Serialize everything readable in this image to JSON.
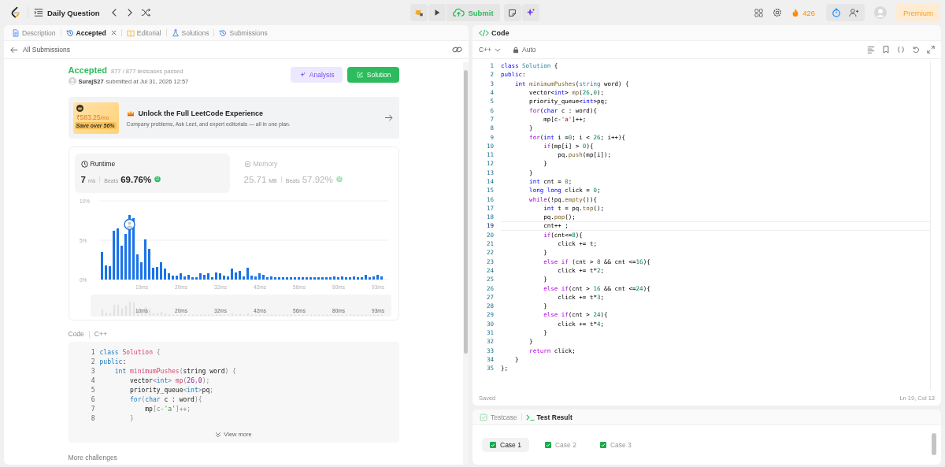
{
  "top_bar": {
    "problem_list": "Daily Question",
    "submit": "Submit",
    "streak": "426",
    "premium": "Premium"
  },
  "left_tabs": [
    {
      "kind": "description",
      "label": "Description",
      "selected": false,
      "closable": false
    },
    {
      "kind": "result",
      "label": "Accepted",
      "selected": true,
      "closable": true
    },
    {
      "kind": "editorial",
      "label": "Editorial",
      "selected": false,
      "closable": false
    },
    {
      "kind": "solutions",
      "label": "Solutions",
      "selected": false,
      "closable": false
    },
    {
      "kind": "submissions",
      "label": "Submissions",
      "selected": false,
      "closable": false
    }
  ],
  "back_link": "All Submissions",
  "submission": {
    "status": "Accepted",
    "testcases": "877 / 877 testcases passed",
    "user": "SurajS27",
    "submitted": "submitted at Jul 31, 2026 12:57",
    "analysis": "Analysis",
    "solution": "Solution"
  },
  "promo": {
    "price": "₹583.25",
    "period": "/mo",
    "save": "Save over 56%",
    "title": "Unlock the Full LeetCode Experience",
    "subtitle": "Company problems, Ask Leet, and expert editorials — all in one plan."
  },
  "stats_panel": {
    "stats": [
      {
        "kind": "runtime",
        "label": "Runtime",
        "value": "7",
        "unit": "ms",
        "beats_label": "Beats",
        "beats": "69.76%",
        "selected": true
      },
      {
        "kind": "memory",
        "label": "Memory",
        "value": "25.71",
        "unit": "MB",
        "beats_label": "Beats",
        "beats": "57.92%",
        "selected": false
      }
    ],
    "chart_data": {
      "type": "bar",
      "ylim": [
        0,
        10
      ],
      "yticks": [
        {
          "value": 0,
          "label": "0%"
        },
        {
          "value": 5,
          "label": "5%"
        },
        {
          "value": 10,
          "label": "10%"
        }
      ],
      "categories": [
        null,
        null,
        null,
        null,
        null,
        null,
        null,
        null,
        null,
        null,
        "10ms",
        null,
        null,
        null,
        null,
        null,
        null,
        null,
        null,
        null,
        "20ms",
        null,
        null,
        null,
        null,
        null,
        null,
        null,
        null,
        null,
        "32ms",
        null,
        null,
        null,
        null,
        null,
        null,
        null,
        null,
        null,
        "42ms",
        null,
        null,
        null,
        null,
        null,
        null,
        null,
        null,
        null,
        "56ms",
        null,
        null,
        null,
        null,
        null,
        null,
        null,
        null,
        null,
        "80ms",
        null,
        null,
        null,
        null,
        null,
        null,
        null,
        null,
        null,
        "93ms",
        null
      ],
      "values": [
        3.5,
        1.8,
        1.7,
        6.2,
        6.5,
        4.3,
        5.8,
        8.2,
        7.8,
        3.2,
        2.2,
        5.1,
        3.9,
        1.5,
        1.6,
        2.2,
        1.4,
        0.8,
        0.5,
        0.5,
        0.8,
        0.4,
        0.6,
        0.3,
        0.3,
        0.8,
        0.6,
        0.8,
        0.3,
        0.9,
        0.8,
        0.5,
        0.4,
        1.4,
        0.9,
        1.1,
        0.4,
        1.5,
        0.5,
        0.4,
        0.8,
        0.6,
        0.3,
        0.4,
        0.3,
        0.3,
        0.3,
        0.3,
        0.3,
        0.3,
        0.3,
        0.3,
        0.3,
        0.3,
        0.3,
        0.3,
        0.3,
        0.3,
        0.3,
        0.4,
        0.3,
        0.4,
        0.3,
        0.3,
        0.4,
        0.3,
        0.3,
        0.6,
        0.3,
        0.4,
        0.6,
        0.4
      ]
    },
    "overview_labels": [
      "10ms",
      "20ms",
      "32ms",
      "42ms",
      "56ms",
      "80ms",
      "93ms"
    ]
  },
  "code_header": {
    "label": "Code",
    "language": "C++"
  },
  "snippet": {
    "view_more": "View more",
    "lines": [
      {
        "no": "1",
        "tokens": [
          {
            "text": "class",
            "kind": "kw"
          },
          {
            "text": " Solution",
            "kind": "type"
          },
          {
            "text": " {",
            "kind": "punct"
          }
        ]
      },
      {
        "no": "2",
        "tokens": [
          {
            "text": "public",
            "kind": "kw"
          },
          {
            "text": ":",
            "kind": "txt"
          }
        ]
      },
      {
        "no": "3",
        "tokens": [
          {
            "text": "    int",
            "kind": "kw"
          },
          {
            "text": " minimumPushes",
            "kind": "fn"
          },
          {
            "text": "(",
            "kind": "punct"
          },
          {
            "text": "string word",
            "kind": "txt"
          },
          {
            "text": ") {",
            "kind": "punct"
          }
        ]
      },
      {
        "no": "4",
        "tokens": [
          {
            "text": "        vector",
            "kind": "txt"
          },
          {
            "text": "<",
            "kind": "punct"
          },
          {
            "text": "int",
            "kind": "kw"
          },
          {
            "text": "> ",
            "kind": "punct"
          },
          {
            "text": "mp",
            "kind": "fn"
          },
          {
            "text": "(",
            "kind": "punct"
          },
          {
            "text": "26",
            "kind": "num"
          },
          {
            "text": ",",
            "kind": "punct"
          },
          {
            "text": "0",
            "kind": "num"
          },
          {
            "text": ");",
            "kind": "punct"
          }
        ]
      },
      {
        "no": "5",
        "tokens": [
          {
            "text": "        priority_queue",
            "kind": "txt"
          },
          {
            "text": "<",
            "kind": "punct"
          },
          {
            "text": "int",
            "kind": "kw"
          },
          {
            "text": ">",
            "kind": "punct"
          },
          {
            "text": "pq",
            "kind": "txt"
          },
          {
            "text": ";",
            "kind": "punct"
          }
        ]
      },
      {
        "no": "6",
        "tokens": [
          {
            "text": "        for",
            "kind": "ctl"
          },
          {
            "text": "(",
            "kind": "punct"
          },
          {
            "text": "char",
            "kind": "kw"
          },
          {
            "text": " c : word",
            "kind": "txt"
          },
          {
            "text": "){",
            "kind": "punct"
          }
        ]
      },
      {
        "no": "7",
        "tokens": [
          {
            "text": "            mp",
            "kind": "txt"
          },
          {
            "text": "[c-",
            "kind": "punct"
          },
          {
            "text": "'a'",
            "kind": "str"
          },
          {
            "text": "]++;",
            "kind": "punct"
          }
        ]
      },
      {
        "no": "8",
        "tokens": [
          {
            "text": "        }",
            "kind": "punct"
          }
        ]
      }
    ]
  },
  "more_challenges": "More challenges",
  "editor": {
    "title": "Code",
    "language": "C++",
    "mode": "Auto",
    "status": "Saved",
    "position": "Ln 19, Col 13",
    "lines": [
      {
        "no": "1",
        "current": false,
        "tokens": [
          {
            "text": "class",
            "kind": "kw"
          },
          {
            "text": " Solution",
            "kind": "type"
          },
          {
            "text": " {",
            "kind": "txt"
          }
        ]
      },
      {
        "no": "2",
        "current": false,
        "tokens": [
          {
            "text": "public",
            "kind": "kw"
          },
          {
            "text": ":",
            "kind": "txt"
          }
        ]
      },
      {
        "no": "3",
        "current": false,
        "tokens": [
          {
            "text": "    int",
            "kind": "kw"
          },
          {
            "text": " minimumPushes",
            "kind": "fn"
          },
          {
            "text": "(",
            "kind": "txt"
          },
          {
            "text": "string",
            "kind": "type"
          },
          {
            "text": " word) {",
            "kind": "txt"
          }
        ]
      },
      {
        "no": "4",
        "current": false,
        "tokens": [
          {
            "text": "        vector<",
            "kind": "txt"
          },
          {
            "text": "int",
            "kind": "kw"
          },
          {
            "text": "> ",
            "kind": "txt"
          },
          {
            "text": "mp",
            "kind": "fn"
          },
          {
            "text": "(",
            "kind": "txt"
          },
          {
            "text": "26",
            "kind": "num"
          },
          {
            "text": ",",
            "kind": "txt"
          },
          {
            "text": "0",
            "kind": "num"
          },
          {
            "text": ");",
            "kind": "txt"
          }
        ]
      },
      {
        "no": "5",
        "current": false,
        "tokens": [
          {
            "text": "        priority_queue<",
            "kind": "txt"
          },
          {
            "text": "int",
            "kind": "kw"
          },
          {
            "text": ">pq;",
            "kind": "txt"
          }
        ]
      },
      {
        "no": "6",
        "current": false,
        "tokens": [
          {
            "text": "        for",
            "kind": "ctl"
          },
          {
            "text": "(",
            "kind": "txt"
          },
          {
            "text": "char",
            "kind": "kw"
          },
          {
            "text": " c : word){",
            "kind": "txt"
          }
        ]
      },
      {
        "no": "7",
        "current": false,
        "tokens": [
          {
            "text": "            mp[c-",
            "kind": "txt"
          },
          {
            "text": "'a'",
            "kind": "str"
          },
          {
            "text": "]++;",
            "kind": "txt"
          }
        ]
      },
      {
        "no": "8",
        "current": false,
        "tokens": [
          {
            "text": "        }",
            "kind": "txt"
          }
        ]
      },
      {
        "no": "9",
        "current": false,
        "tokens": [
          {
            "text": "        for",
            "kind": "ctl"
          },
          {
            "text": "(",
            "kind": "txt"
          },
          {
            "text": "int",
            "kind": "kw"
          },
          {
            "text": " i =",
            "kind": "txt"
          },
          {
            "text": "0",
            "kind": "num"
          },
          {
            "text": "; i < ",
            "kind": "txt"
          },
          {
            "text": "26",
            "kind": "num"
          },
          {
            "text": "; i++){",
            "kind": "txt"
          }
        ]
      },
      {
        "no": "10",
        "current": false,
        "tokens": [
          {
            "text": "            if",
            "kind": "ctl"
          },
          {
            "text": "(mp[i] > ",
            "kind": "txt"
          },
          {
            "text": "0",
            "kind": "num"
          },
          {
            "text": "){",
            "kind": "txt"
          }
        ]
      },
      {
        "no": "11",
        "current": false,
        "tokens": [
          {
            "text": "                pq.",
            "kind": "txt"
          },
          {
            "text": "push",
            "kind": "fn"
          },
          {
            "text": "(mp[i]);",
            "kind": "txt"
          }
        ]
      },
      {
        "no": "12",
        "current": false,
        "tokens": [
          {
            "text": "            }",
            "kind": "txt"
          }
        ]
      },
      {
        "no": "13",
        "current": false,
        "tokens": [
          {
            "text": "        }",
            "kind": "txt"
          }
        ]
      },
      {
        "no": "14",
        "current": false,
        "tokens": [
          {
            "text": "        int",
            "kind": "kw"
          },
          {
            "text": " cnt = ",
            "kind": "txt"
          },
          {
            "text": "0",
            "kind": "num"
          },
          {
            "text": ";",
            "kind": "txt"
          }
        ]
      },
      {
        "no": "15",
        "current": false,
        "tokens": [
          {
            "text": "        long",
            "kind": "kw"
          },
          {
            "text": " long",
            "kind": "kw"
          },
          {
            "text": " click = ",
            "kind": "txt"
          },
          {
            "text": "0",
            "kind": "num"
          },
          {
            "text": ";",
            "kind": "txt"
          }
        ]
      },
      {
        "no": "16",
        "current": false,
        "tokens": [
          {
            "text": "        while",
            "kind": "ctl"
          },
          {
            "text": "(!pq.",
            "kind": "txt"
          },
          {
            "text": "empty",
            "kind": "fn"
          },
          {
            "text": "()){",
            "kind": "txt"
          }
        ]
      },
      {
        "no": "17",
        "current": false,
        "tokens": [
          {
            "text": "            int",
            "kind": "kw"
          },
          {
            "text": " t = pq.",
            "kind": "txt"
          },
          {
            "text": "top",
            "kind": "fn"
          },
          {
            "text": "();",
            "kind": "txt"
          }
        ]
      },
      {
        "no": "18",
        "current": false,
        "tokens": [
          {
            "text": "            pq.",
            "kind": "txt"
          },
          {
            "text": "pop",
            "kind": "fn"
          },
          {
            "text": "();",
            "kind": "txt"
          }
        ]
      },
      {
        "no": "19",
        "current": true,
        "tokens": [
          {
            "text": "            cnt++ ;",
            "kind": "txt"
          }
        ]
      },
      {
        "no": "20",
        "current": false,
        "tokens": [
          {
            "text": "            if",
            "kind": "ctl"
          },
          {
            "text": "(cnt<=",
            "kind": "txt"
          },
          {
            "text": "8",
            "kind": "num"
          },
          {
            "text": "){",
            "kind": "txt"
          }
        ]
      },
      {
        "no": "21",
        "current": false,
        "tokens": [
          {
            "text": "                click += t;",
            "kind": "txt"
          }
        ]
      },
      {
        "no": "22",
        "current": false,
        "tokens": [
          {
            "text": "            }",
            "kind": "txt"
          }
        ]
      },
      {
        "no": "23",
        "current": false,
        "tokens": [
          {
            "text": "            else",
            "kind": "ctl"
          },
          {
            "text": " if",
            "kind": "ctl"
          },
          {
            "text": " (cnt > ",
            "kind": "txt"
          },
          {
            "text": "8",
            "kind": "num"
          },
          {
            "text": " && cnt <=",
            "kind": "txt"
          },
          {
            "text": "16",
            "kind": "num"
          },
          {
            "text": "){",
            "kind": "txt"
          }
        ]
      },
      {
        "no": "24",
        "current": false,
        "tokens": [
          {
            "text": "                click += t*",
            "kind": "txt"
          },
          {
            "text": "2",
            "kind": "num"
          },
          {
            "text": ";",
            "kind": "txt"
          }
        ]
      },
      {
        "no": "25",
        "current": false,
        "tokens": [
          {
            "text": "            }",
            "kind": "txt"
          }
        ]
      },
      {
        "no": "26",
        "current": false,
        "tokens": [
          {
            "text": "            else",
            "kind": "ctl"
          },
          {
            "text": " if",
            "kind": "ctl"
          },
          {
            "text": "(cnt > ",
            "kind": "txt"
          },
          {
            "text": "16",
            "kind": "num"
          },
          {
            "text": " && cnt <=",
            "kind": "txt"
          },
          {
            "text": "24",
            "kind": "num"
          },
          {
            "text": "){",
            "kind": "txt"
          }
        ]
      },
      {
        "no": "27",
        "current": false,
        "tokens": [
          {
            "text": "                click += t*",
            "kind": "txt"
          },
          {
            "text": "3",
            "kind": "num"
          },
          {
            "text": ";",
            "kind": "txt"
          }
        ]
      },
      {
        "no": "28",
        "current": false,
        "tokens": [
          {
            "text": "            }",
            "kind": "txt"
          }
        ]
      },
      {
        "no": "29",
        "current": false,
        "tokens": [
          {
            "text": "            else",
            "kind": "ctl"
          },
          {
            "text": " if",
            "kind": "ctl"
          },
          {
            "text": "(cnt > ",
            "kind": "txt"
          },
          {
            "text": "24",
            "kind": "num"
          },
          {
            "text": "){",
            "kind": "txt"
          }
        ]
      },
      {
        "no": "30",
        "current": false,
        "tokens": [
          {
            "text": "                click += t*",
            "kind": "txt"
          },
          {
            "text": "4",
            "kind": "num"
          },
          {
            "text": ";",
            "kind": "txt"
          }
        ]
      },
      {
        "no": "31",
        "current": false,
        "tokens": [
          {
            "text": "            }",
            "kind": "txt"
          }
        ]
      },
      {
        "no": "32",
        "current": false,
        "tokens": [
          {
            "text": "        }",
            "kind": "txt"
          }
        ]
      },
      {
        "no": "33",
        "current": false,
        "tokens": [
          {
            "text": "        return",
            "kind": "ctl"
          },
          {
            "text": " click;",
            "kind": "txt"
          }
        ]
      },
      {
        "no": "34",
        "current": false,
        "tokens": [
          {
            "text": "    }",
            "kind": "txt"
          }
        ]
      },
      {
        "no": "35",
        "current": false,
        "tokens": [
          {
            "text": "};",
            "kind": "txt"
          }
        ]
      }
    ]
  },
  "bottom_tabs": [
    {
      "kind": "testcase",
      "label": "Testcase",
      "selected": false
    },
    {
      "kind": "result",
      "label": "Test Result",
      "selected": true
    }
  ],
  "cases": [
    {
      "label": "Case 1",
      "selected": true,
      "passed": true
    },
    {
      "label": "Case 2",
      "selected": false,
      "passed": true
    },
    {
      "label": "Case 3",
      "selected": false,
      "passed": true
    }
  ]
}
